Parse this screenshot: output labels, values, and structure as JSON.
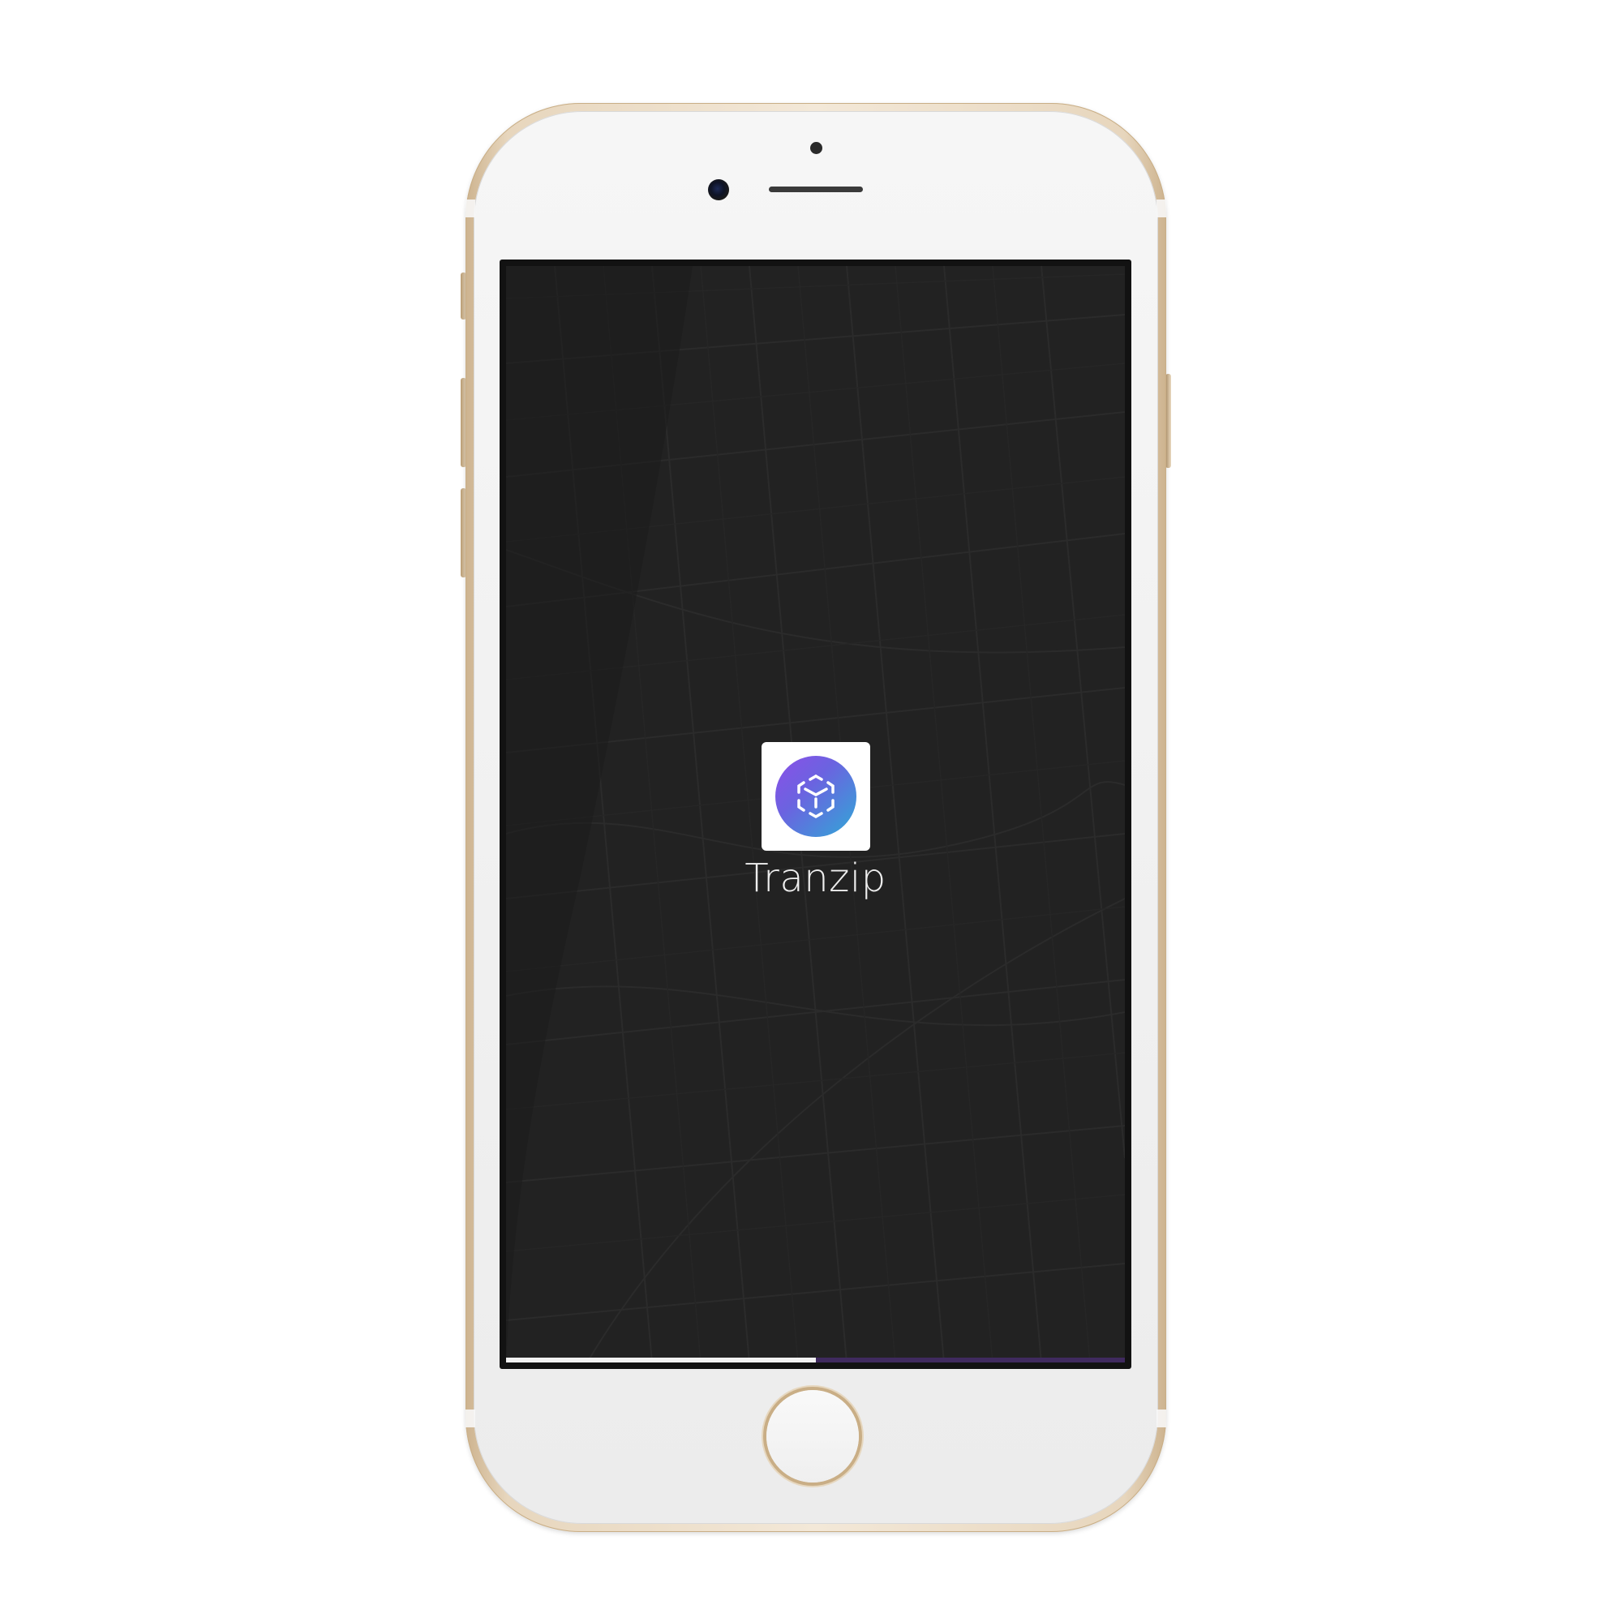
{
  "app": {
    "name": "Tranzip",
    "logo_icon": "cube-logo-icon"
  },
  "splash": {
    "loading_progress": 0.5
  },
  "colors": {
    "screen_background": "#222222",
    "map_lines": "#2c2c2c",
    "progress_fill": "#f2f2f2",
    "progress_track": "#3f2a5e",
    "logo_gradient_start": "#8c4fe8",
    "logo_gradient_end": "#30a8d6",
    "device_frame": "#e7d6bd"
  },
  "device": {
    "model": "iphone",
    "color": "gold"
  }
}
